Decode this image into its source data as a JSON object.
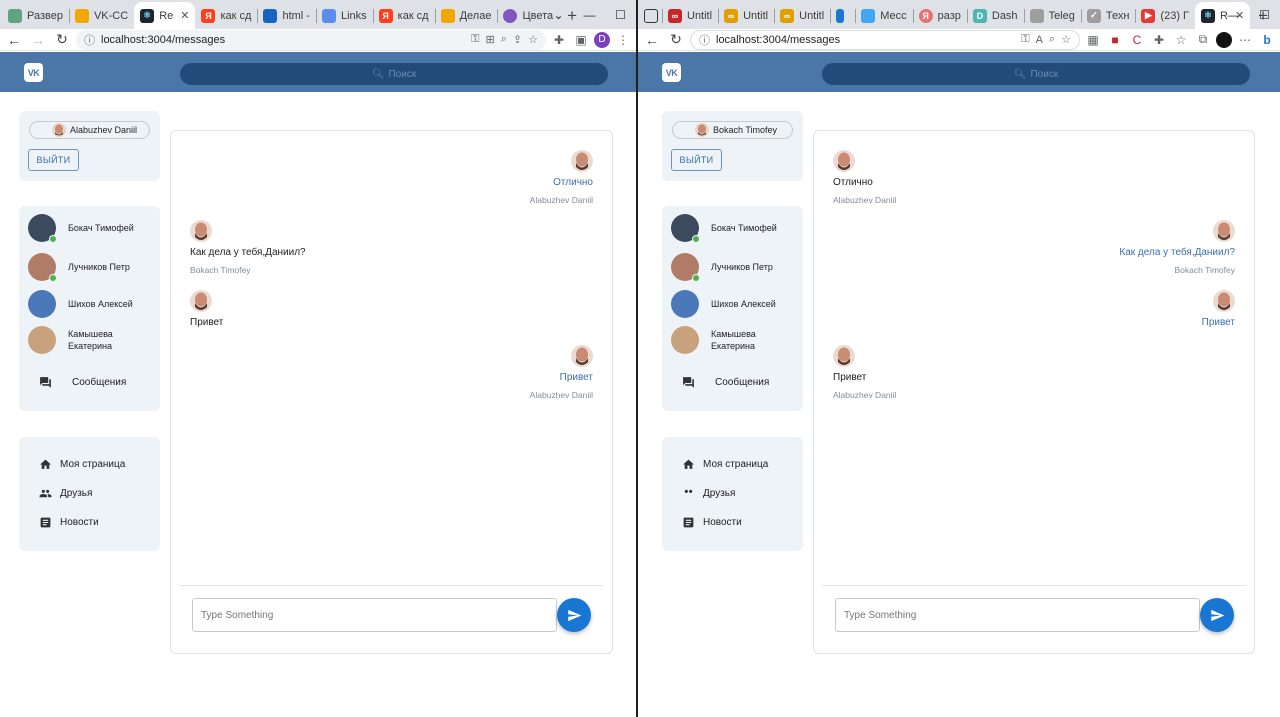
{
  "left_window": {
    "tabs": [
      {
        "label": "Развер",
        "icon": "app-icon",
        "color": "#5fa381"
      },
      {
        "label": "VK-CC",
        "icon": "folder-icon",
        "color": "#f2a600"
      },
      {
        "label": "Re",
        "icon": "react-icon",
        "color": "#20232a",
        "active": true
      },
      {
        "label": "как сд",
        "icon": "yandex-icon",
        "color": "#fc3f1d"
      },
      {
        "label": "html -",
        "icon": "stackoverflow-icon",
        "color": "#1565c0"
      },
      {
        "label": "Links",
        "icon": "link-icon",
        "color": "#5b8def"
      },
      {
        "label": "как сд",
        "icon": "yandex-icon",
        "color": "#fc3f1d"
      },
      {
        "label": "Делае",
        "icon": "bookmark-icon",
        "color": "#f2a600"
      },
      {
        "label": "Цвета",
        "icon": "chrome-icon",
        "color": "#7e57c2"
      }
    ],
    "url": "localhost:3004/messages",
    "profile_initial": "D"
  },
  "right_window": {
    "tabs": [
      {
        "label": "Untitl",
        "icon": "infinity-icon",
        "color": "#c62828"
      },
      {
        "label": "Untitl",
        "icon": "infinity-icon",
        "color": "#e0a100"
      },
      {
        "label": "Untitl",
        "icon": "infinity-icon",
        "color": "#e0a100"
      },
      {
        "label": "",
        "icon": "phone-icon",
        "color": "#1976d2"
      },
      {
        "label": "Месс",
        "icon": "chat-icon",
        "color": "#42a5f5"
      },
      {
        "label": "разр",
        "icon": "yandex-icon",
        "color": "#e57373"
      },
      {
        "label": "Dash",
        "icon": "dash-icon",
        "color": "#4db6ac"
      },
      {
        "label": "Teleg",
        "icon": "doc-icon",
        "color": "#9e9e9e"
      },
      {
        "label": "Техн",
        "icon": "check-icon",
        "color": "#9e9e9e"
      },
      {
        "label": "(23) Г",
        "icon": "youtube-icon",
        "color": "#e53935"
      },
      {
        "label": "R",
        "icon": "react-icon",
        "color": "#20232a",
        "active": true
      }
    ],
    "url": "localhost:3004/messages"
  },
  "app": {
    "logo": "VK",
    "search_placeholder": "Поиск",
    "logout_label": "ВЫЙТИ",
    "friends": [
      {
        "name": "Бокач Тимофей",
        "online": true,
        "avatar_color": "#3b4a5c"
      },
      {
        "name": "Лучников Петр",
        "online": true,
        "avatar_color": "#b07c67"
      },
      {
        "name": "Шихов Алексей",
        "online": false,
        "avatar_color": "#4a78b8"
      },
      {
        "name": "Камышева Екатерина",
        "online": false,
        "avatar_color": "#c8a27d"
      }
    ],
    "messages_link": "Сообщения",
    "nav": [
      {
        "label": "Моя страница",
        "icon": "home-icon"
      },
      {
        "label": "Друзья",
        "icon": "people-icon"
      },
      {
        "label": "Новости",
        "icon": "news-icon"
      }
    ],
    "input_placeholder": "Type Something"
  },
  "left_chat": {
    "current_user": "Alabuzhev Daniil",
    "messages": [
      {
        "text": "Отлично",
        "author": "Alabuzhev Daniil",
        "mine": true
      },
      {
        "text": "Как дела у тебя,Даниил?",
        "author": "Bokach Timofey",
        "mine": false
      },
      {
        "text": "Привет",
        "author": "",
        "mine": false
      },
      {
        "text": "Привет",
        "author": "Alabuzhev Daniil",
        "mine": true
      }
    ]
  },
  "right_chat": {
    "current_user": "Bokach Timofey",
    "messages": [
      {
        "text": "Отлично",
        "author": "Alabuzhev Daniil",
        "mine": false
      },
      {
        "text": "Как дела у тебя,Даниил?",
        "author": "Bokach Timofey",
        "mine": true
      },
      {
        "text": "Привет",
        "author": "",
        "mine": true
      },
      {
        "text": "Привет",
        "author": "Alabuzhev Daniil",
        "mine": false
      }
    ]
  },
  "colors": {
    "header": "#4a76a8",
    "search": "#224b7a",
    "panel": "#eef3f8",
    "accent": "#1976d2",
    "online": "#4bb34b"
  }
}
